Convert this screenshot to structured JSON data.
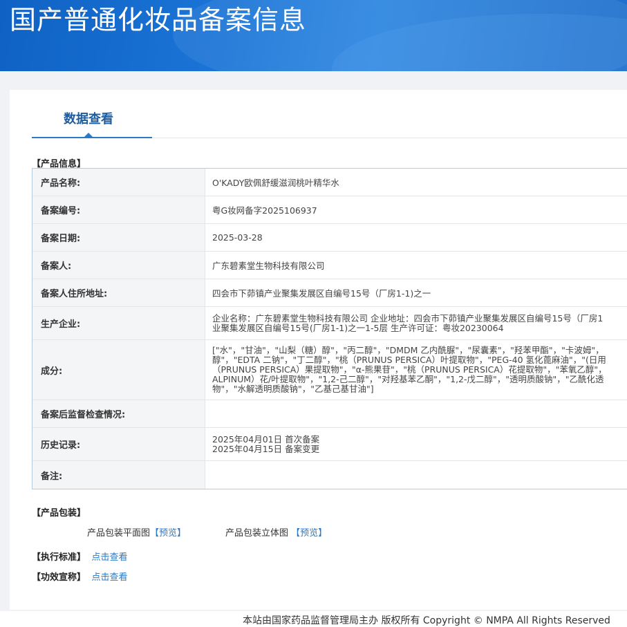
{
  "header": {
    "title": "国产普通化妆品备案信息"
  },
  "tabs": [
    {
      "label": "数据查看"
    }
  ],
  "product_info": {
    "section_title": "【产品信息】",
    "rows": [
      {
        "label": "产品名称:",
        "lines": [
          "O'KADY欧佩舒缓滋润桃叶精华水"
        ]
      },
      {
        "label": "备案编号:",
        "lines": [
          "粤G妆网备字2025106937"
        ]
      },
      {
        "label": "备案日期:",
        "lines": [
          "2025-03-28"
        ]
      },
      {
        "label": "备案人:",
        "lines": [
          "广东碧素堂生物科技有限公司"
        ]
      },
      {
        "label": "备案人住所地址:",
        "lines": [
          "四会市下茆镇产业聚集发展区自编号15号（厂房1-1)之一"
        ]
      },
      {
        "label": "生产企业:",
        "lines": [
          "企业名称：广东碧素堂生物科技有限公司 企业地址：四会市下茆镇产业聚集发展区自编号15号（厂房1",
          "业聚集发展区自编号15号(厂房1-1)之一1-5层 生产许可证：粤妆20230064"
        ]
      },
      {
        "label": "成分:",
        "lines": [
          "[\"水\"，\"甘油\"，\"山梨（糖）醇\"，\"丙二醇\"，\"DMDM 乙内酰脲\"，\"尿囊素\"，\"羟苯甲酯\"，\"卡波姆\"，",
          "醇\"，\"EDTA 二钠\"，\"丁二醇\"，\"桃（PRUNUS PERSICA）叶提取物\"，\"PEG-40 氢化蓖麻油\"，\"(日用",
          "（PRUNUS PERSICA）果提取物\"，\"α-熊果苷\"，\"桃（PRUNUS PERSICA）花提取物\"，\"苯氧乙醇\"，",
          "ALPINUM）花/叶提取物\"，\"1,2-己二醇\"，\"对羟基苯乙酮\"，\"1,2-戊二醇\"，\"透明质酸钠\"，\"乙酰化透",
          "物\"，\"水解透明质酸钠\"，\"乙基己基甘油\"]"
        ]
      },
      {
        "label": "备案后监督检查情况:",
        "lines": [
          ""
        ]
      },
      {
        "label": "历史记录:",
        "lines": [
          "2025年04月01日 首次备案",
          "2025年04月15日 备案变更"
        ]
      },
      {
        "label": "备注:",
        "lines": [
          ""
        ]
      }
    ]
  },
  "packaging": {
    "section_title": "【产品包装】",
    "flat_label": "产品包装平面图",
    "flat_link": "【预览】",
    "stereo_label": "产品包装立体图",
    "stereo_link": "【预览】"
  },
  "standard": {
    "section_title": "【执行标准】",
    "link": "点击查看"
  },
  "efficacy": {
    "section_title": "【功效宣称】",
    "link": "点击查看"
  },
  "footer": {
    "text": "本站由国家药品监督管理局主办 版权所有 Copyright © NMPA All Rights Reserved"
  },
  "colors": {
    "banner": "#1a74d6",
    "link": "#2a79c9",
    "tab_text": "#1d5c9e"
  }
}
